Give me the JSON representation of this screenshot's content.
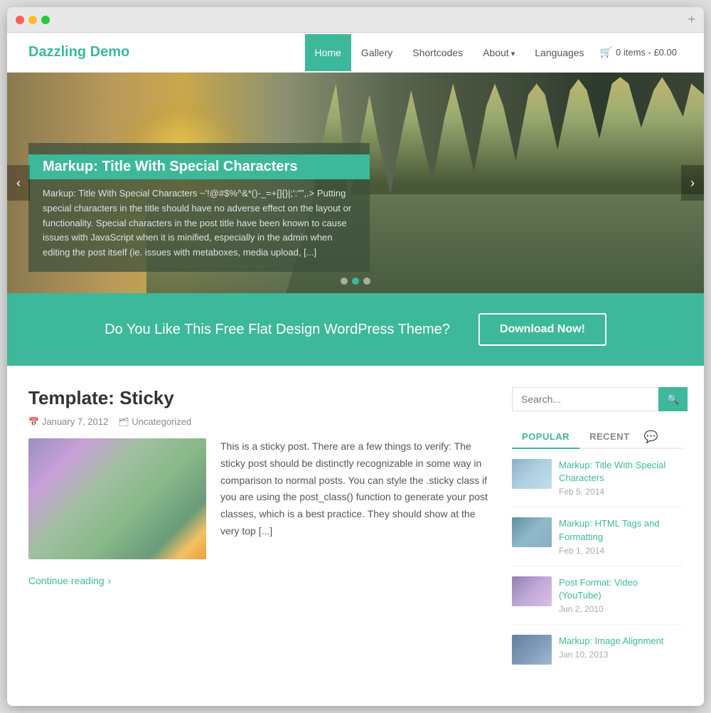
{
  "browser": {
    "add_label": "+"
  },
  "header": {
    "logo": "Dazzling Demo",
    "nav": [
      {
        "label": "Home",
        "active": true
      },
      {
        "label": "Gallery",
        "active": false
      },
      {
        "label": "Shortcodes",
        "active": false
      },
      {
        "label": "About",
        "active": false,
        "dropdown": true
      },
      {
        "label": "Languages",
        "active": false
      }
    ],
    "cart": "0 items - £0.00"
  },
  "slider": {
    "title": "Markup: Title With Special Characters",
    "text": "Markup: Title With Special Characters ~'!@#$%^&*()-_=+[]{}|;':\"\",.> Putting special characters in the title should have no adverse effect on the layout or functionality. Special characters in the post title have been known to cause issues with JavaScript when it is minified, especially in the admin when editing the post itself (ie. issues with metaboxes, media upload, [...]",
    "prev": "‹",
    "next": "›"
  },
  "cta": {
    "text": "Do You Like This Free Flat Design WordPress Theme?",
    "button": "Download Now!"
  },
  "post": {
    "title": "Template: Sticky",
    "meta_date": "January 7, 2012",
    "meta_category": "Uncategorized",
    "excerpt": "This is a sticky post. There are a few things to verify: The sticky post should be distinctly recognizable in some way in comparison to normal posts. You can style the .sticky class if you are using the post_class() function to generate your post classes, which is a best practice. They should show at the very top [...]",
    "read_more": "Continue reading"
  },
  "sidebar": {
    "search_placeholder": "Search...",
    "tabs": [
      {
        "label": "POPULAR",
        "active": true
      },
      {
        "label": "RECENT",
        "active": false
      }
    ],
    "posts": [
      {
        "title": "Markup: Title With Special Characters",
        "date": "Feb 5, 2014",
        "thumb_class": "thumb1"
      },
      {
        "title": "Markup: HTML Tags and Formatting",
        "date": "Feb 1, 2014",
        "thumb_class": "thumb2"
      },
      {
        "title": "Post Format: Video (YouTube)",
        "date": "Jun 2, 2010",
        "thumb_class": "thumb3"
      },
      {
        "title": "Markup: Image Alignment",
        "date": "Jan 10, 2013",
        "thumb_class": "thumb4"
      }
    ]
  }
}
